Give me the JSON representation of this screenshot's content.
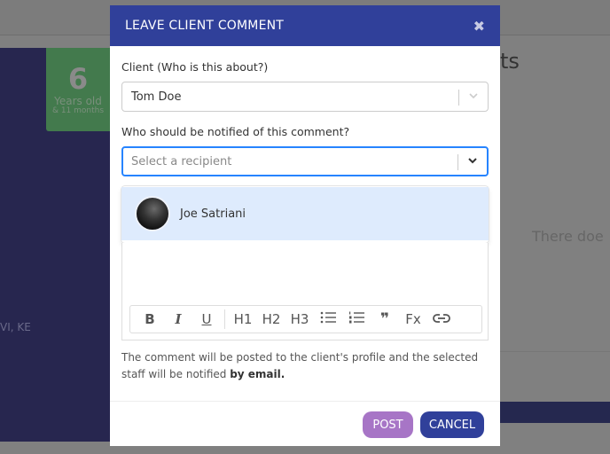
{
  "background": {
    "age_number": "6",
    "age_label": "Years old",
    "age_sub": "& 11 months",
    "sidebar_text": "VI, KE",
    "section_title_fragment": "ts",
    "empty_text_fragment": "There doe"
  },
  "modal": {
    "title": "LEAVE CLIENT COMMENT",
    "close_icon": "close-icon",
    "client_label": "Client (Who is this about?)",
    "client_value": "Tom Doe",
    "recipient_label": "Who should be notified of this comment?",
    "recipient_placeholder": "Select a recipient",
    "recipient_options": [
      {
        "name": "Joe Satriani"
      }
    ],
    "toolbar": [
      "B",
      "I",
      "U",
      "H1",
      "H2",
      "H3",
      "bullet-list",
      "numbered-list",
      "quote",
      "Fx",
      "link"
    ],
    "toolbar_labels": {
      "h1": "H1",
      "h2": "H2",
      "h3": "H3",
      "fx": "Fx",
      "b": "B",
      "i": "I",
      "u": "U",
      "quote": "❞"
    },
    "note_text": "The comment will be posted to the client's profile and the selected staff will be notified ",
    "note_bold": "by email.",
    "post_label": "POST",
    "cancel_label": "CANCEL"
  },
  "colors": {
    "header": "#30409a",
    "post": "#a775c6",
    "cancel": "#30409a",
    "focus": "#2684ff",
    "option_highlight": "#deebfd"
  }
}
